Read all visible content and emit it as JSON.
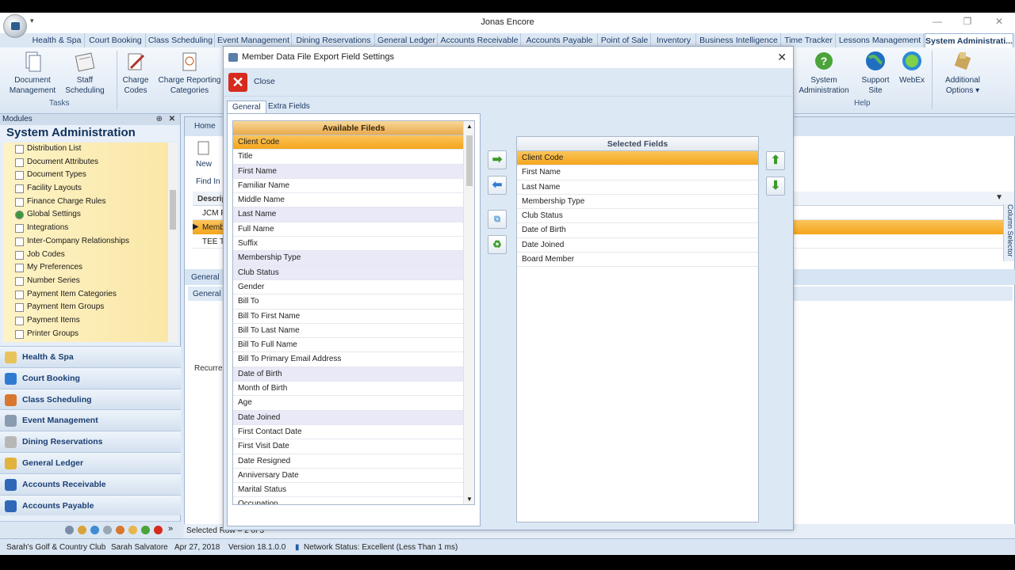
{
  "app": {
    "title": "Jonas Encore"
  },
  "tabs": [
    "Health & Spa",
    "Court Booking",
    "Class Scheduling",
    "Event Management",
    "Dining Reservations",
    "General Ledger",
    "Accounts Receivable",
    "Accounts Payable",
    "Point of Sale",
    "Inventory",
    "Business Intelligence",
    "Time Tracker",
    "Lessons Management",
    "System Administrati..."
  ],
  "ribbon": {
    "document_management": "Document Management",
    "staff_scheduling": "Staff Scheduling",
    "tasks_group": "Tasks",
    "charge_codes": "Charge Codes",
    "charge_reporting": "Charge Reporting Categories",
    "system_administration": "System Administration",
    "support_site": "Support Site",
    "webex": "WebEx",
    "help_group": "Help",
    "additional_options": "Additional Options ▾"
  },
  "modules": {
    "header": "Modules",
    "title": "System Administration",
    "tree": [
      "Distribution List",
      "Document Attributes",
      "Document Types",
      "Facility Layouts",
      "Finance Charge Rules",
      "Global Settings",
      "Integrations",
      "Inter-Company Relationships",
      "Job Codes",
      "My Preferences",
      "Number Series",
      "Payment Item Categories",
      "Payment Item Groups",
      "Payment Items",
      "Printer Groups"
    ],
    "buttons": [
      "Health & Spa",
      "Court Booking",
      "Class Scheduling",
      "Event Management",
      "Dining Reservations",
      "General Ledger",
      "Accounts Receivable",
      "Accounts Payable"
    ]
  },
  "main": {
    "home_tab": "Home",
    "new": "New",
    "find": "Find In",
    "col_desc": "Descrip",
    "rows": [
      "JCM PA",
      "Memb",
      "TEE TII"
    ],
    "general_tab": "General",
    "general_sub": "General S",
    "recurrence": "Recurren",
    "column_selector": "Column Selector",
    "selected_row": "Selected Row = 2 of 3"
  },
  "dialog": {
    "title": "Member Data File Export Field Settings",
    "close_label": "Close",
    "tab_general": "General",
    "tab_extra": "Extra Fields",
    "available_header": "Available Fileds",
    "available": [
      "Client Code",
      "Title",
      "First Name",
      "Familiar Name",
      "Middle Name",
      "Last Name",
      "Full Name",
      "Suffix",
      "Membership Type",
      "Club Status",
      "Gender",
      "Bill To",
      "Bill To First Name",
      "Bill To Last Name",
      "Bill To Full Name",
      "Bill To Primary Email Address",
      "Date of Birth",
      "Month of Birth",
      "Age",
      "Date Joined",
      "First Contact Date",
      "First Visit Date",
      "Date Resigned",
      "Anniversary Date",
      "Marital Status",
      "Occupation"
    ],
    "selected_header": "Selected Fields",
    "selected": [
      "Client Code",
      "First Name",
      "Last Name",
      "Membership Type",
      "Club Status",
      "Date of Birth",
      "Date Joined",
      "Board Member"
    ]
  },
  "status": {
    "club": "Sarah's Golf & Country Club",
    "user": "Sarah Salvatore",
    "date": "Apr 27, 2018",
    "version": "Version 18.1.0.0",
    "network": "Network Status: Excellent (Less Than 1 ms)"
  }
}
